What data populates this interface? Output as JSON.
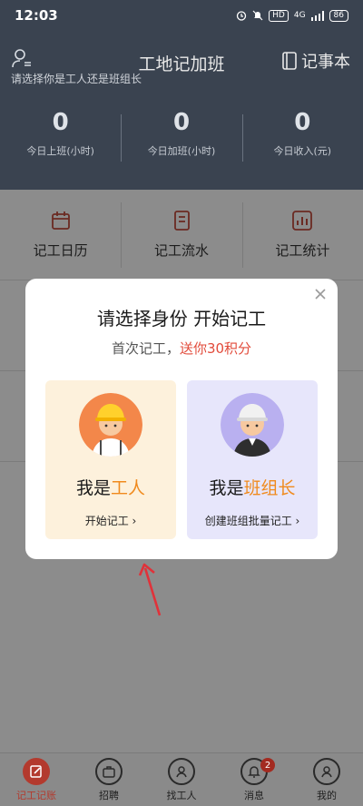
{
  "status_bar": {
    "time": "12:03",
    "hd": "HD",
    "network": "4G",
    "battery": "86"
  },
  "header": {
    "title": "工地记加班",
    "subtitle": "请选择你是工人还是班组长",
    "notebook_label": "记事本"
  },
  "stats": [
    {
      "value": "0",
      "label": "今日上班(小时)"
    },
    {
      "value": "0",
      "label": "今日加班(小时)"
    },
    {
      "value": "0",
      "label": "今日收入(元)"
    }
  ],
  "tools": [
    {
      "label": "记工日历",
      "icon": "calendar-icon"
    },
    {
      "label": "记工流水",
      "icon": "ledger-icon"
    },
    {
      "label": "记工统计",
      "icon": "chart-icon"
    }
  ],
  "modal": {
    "title": "请选择身份 开始记工",
    "subtitle_prefix": "首次记工，",
    "subtitle_highlight": "送你30积分",
    "worker": {
      "prefix": "我是",
      "role": "工人",
      "action": "开始记工 ›"
    },
    "leader": {
      "prefix": "我是",
      "role": "班组长",
      "action": "创建班组批量记工 ›"
    }
  },
  "bottom_nav": [
    {
      "label": "记工记账",
      "icon": "edit-icon",
      "active": true
    },
    {
      "label": "招聘",
      "icon": "briefcase-icon"
    },
    {
      "label": "找工人",
      "icon": "person-search-icon"
    },
    {
      "label": "消息",
      "icon": "bell-icon",
      "badge": "2"
    },
    {
      "label": "我的",
      "icon": "user-icon"
    }
  ],
  "colors": {
    "header_bg": "#3a4350",
    "accent_orange": "#f08a1d",
    "accent_red": "#e24b3b",
    "nav_active": "#b33a2e"
  }
}
